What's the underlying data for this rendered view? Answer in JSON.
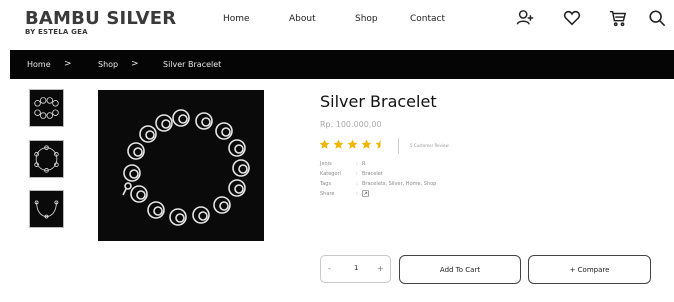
{
  "brand": {
    "title": "BAMBU SILVER",
    "subtitle": "BY ESTELA GEA"
  },
  "nav": {
    "items": [
      "Home",
      "About",
      "Shop",
      "Contact"
    ]
  },
  "header_icons": [
    "add-user-icon",
    "heart-icon",
    "cart-icon",
    "search-icon"
  ],
  "breadcrumb": {
    "items": [
      "Home",
      "Shop",
      "Silver Bracelet"
    ],
    "separator": ">"
  },
  "product": {
    "title": "Silver Bracelet",
    "price": "Rp. 100.000,00",
    "rating": 4.5,
    "rating_max": 5,
    "star_color": "#f2b705",
    "review_text": "5 Customer Review",
    "meta": [
      {
        "key": "Jenis",
        "value": "R"
      },
      {
        "key": "Kategori",
        "value": "Bracelet"
      },
      {
        "key": "Tags",
        "value": "Bracelets, Silver, Home, Shop"
      },
      {
        "key": "Share",
        "value": ""
      }
    ]
  },
  "actions": {
    "qty_minus": "-",
    "qty_value": "1",
    "qty_plus": "+",
    "add_to_cart": "Add To Cart",
    "compare": "+ Compare"
  },
  "thumbnails_count": 3
}
